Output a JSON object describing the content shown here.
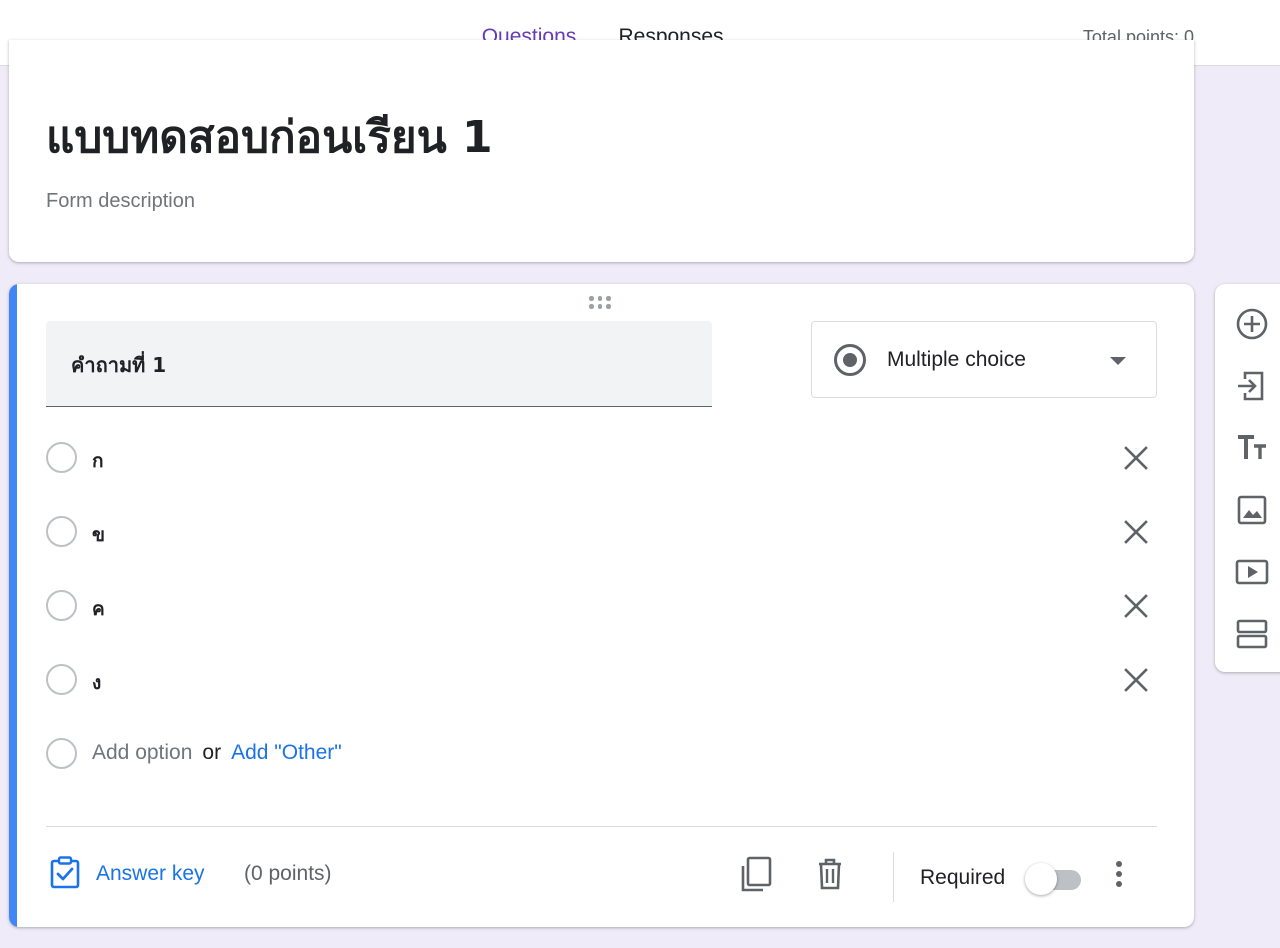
{
  "header": {
    "tabs": [
      {
        "label": "Questions",
        "active": true
      },
      {
        "label": "Responses",
        "active": false
      }
    ],
    "total_points": "Total points: 0"
  },
  "form": {
    "title": "แบบทดสอบก่อนเรียน 1",
    "description_placeholder": "Form description"
  },
  "question": {
    "title": "คำถามที่ 1",
    "type": "Multiple choice",
    "options": [
      {
        "label": "ก"
      },
      {
        "label": "ข"
      },
      {
        "label": "ค"
      },
      {
        "label": "ง"
      }
    ],
    "add_option": "Add option",
    "or": "or",
    "add_other": "Add \"Other\"",
    "answer_key": "Answer key",
    "points": "(0 points)",
    "required_label": "Required",
    "required": false
  },
  "sidebar": {
    "icons": [
      "add-question-icon",
      "import-questions-icon",
      "add-title-icon",
      "add-image-icon",
      "add-video-icon",
      "add-section-icon"
    ]
  },
  "colors": {
    "accent": "#673ab7",
    "active_question": "#4285f4",
    "link": "#1a73e8",
    "background": "#f0ebf8"
  }
}
